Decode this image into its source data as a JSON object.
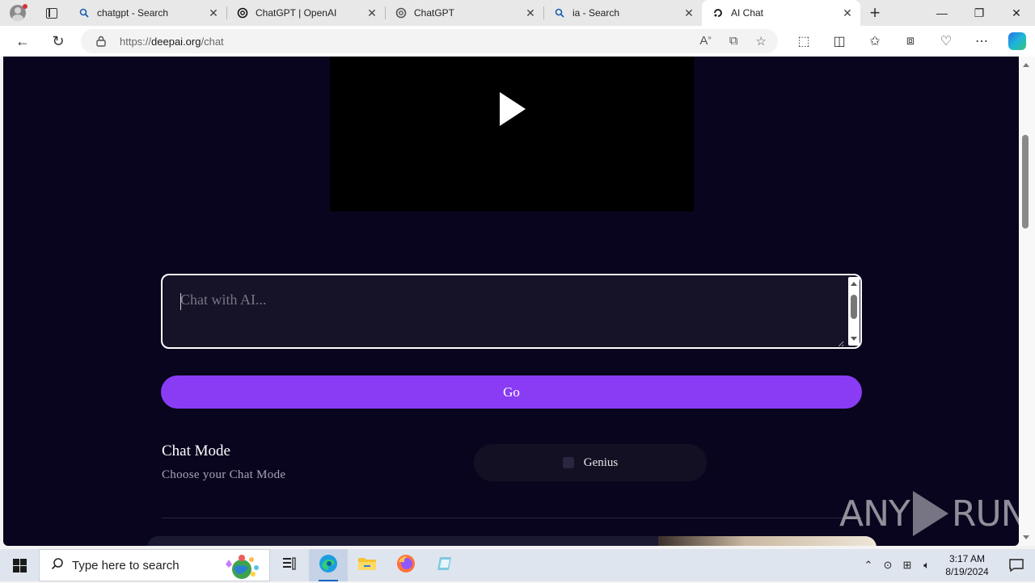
{
  "browser": {
    "tabs": [
      {
        "title": "chatgpt - Search",
        "icon": "search-icon"
      },
      {
        "title": "ChatGPT | OpenAI",
        "icon": "openai-icon"
      },
      {
        "title": "ChatGPT",
        "icon": "openai-icon"
      },
      {
        "title": "ia - Search",
        "icon": "search-icon"
      },
      {
        "title": "AI Chat",
        "icon": "deepai-icon",
        "active": true
      }
    ],
    "url_prefix": "https://",
    "url_host": "deepai.org",
    "url_path": "/chat"
  },
  "page": {
    "chat_placeholder": "Chat with AI...",
    "go_label": "Go",
    "chat_mode_title": "Chat Mode",
    "chat_mode_subtitle": "Choose your Chat Mode",
    "mode_option": "Genius",
    "watermark_left": "ANY",
    "watermark_right": "RUN",
    "accent_color": "#8a3cf5",
    "background_color": "#09051e"
  },
  "taskbar": {
    "search_placeholder": "Type here to search",
    "time": "3:17 AM",
    "date": "8/19/2024"
  }
}
